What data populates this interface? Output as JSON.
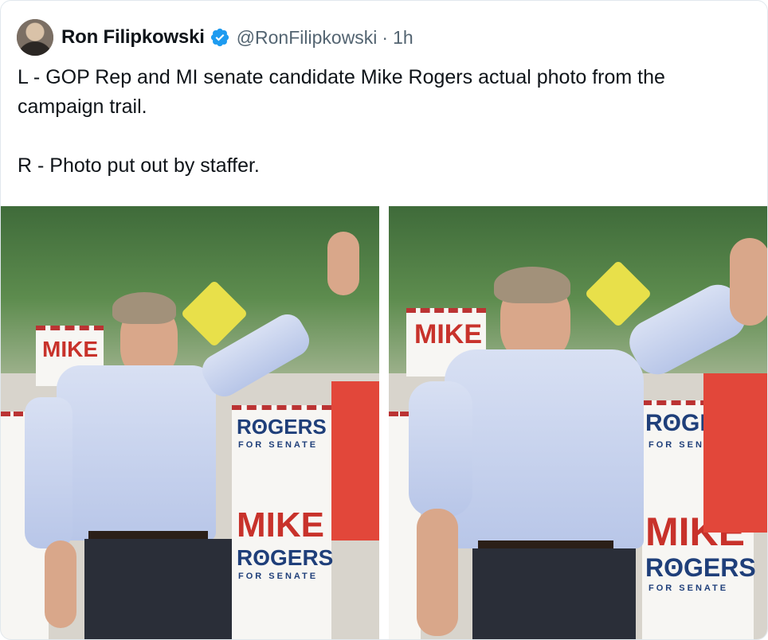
{
  "tweet": {
    "author_name": "Ron Filipkowski",
    "handle": "@RonFilipkowski",
    "separator": "·",
    "time": "1h",
    "text_lines": [
      "L - GOP Rep and MI senate candidate Mike Rogers actual photo from the campaign trail.",
      "R - Photo put out by staffer."
    ]
  },
  "photos": {
    "left": {
      "banner_word_1": "MIKE",
      "banner_word_2": "RʘGERS",
      "banner_sub": "FOR SENATE"
    },
    "right": {
      "banner_word_1": "MIKE",
      "banner_word_2": "RʘGERS",
      "banner_sub": "FOR SENATE"
    }
  },
  "colors": {
    "verified_blue": "#1d9bf0",
    "handle_gray": "#536471",
    "text": "#0f1419"
  },
  "icons": {
    "verified": "verified-badge-icon",
    "avatar": "avatar"
  }
}
